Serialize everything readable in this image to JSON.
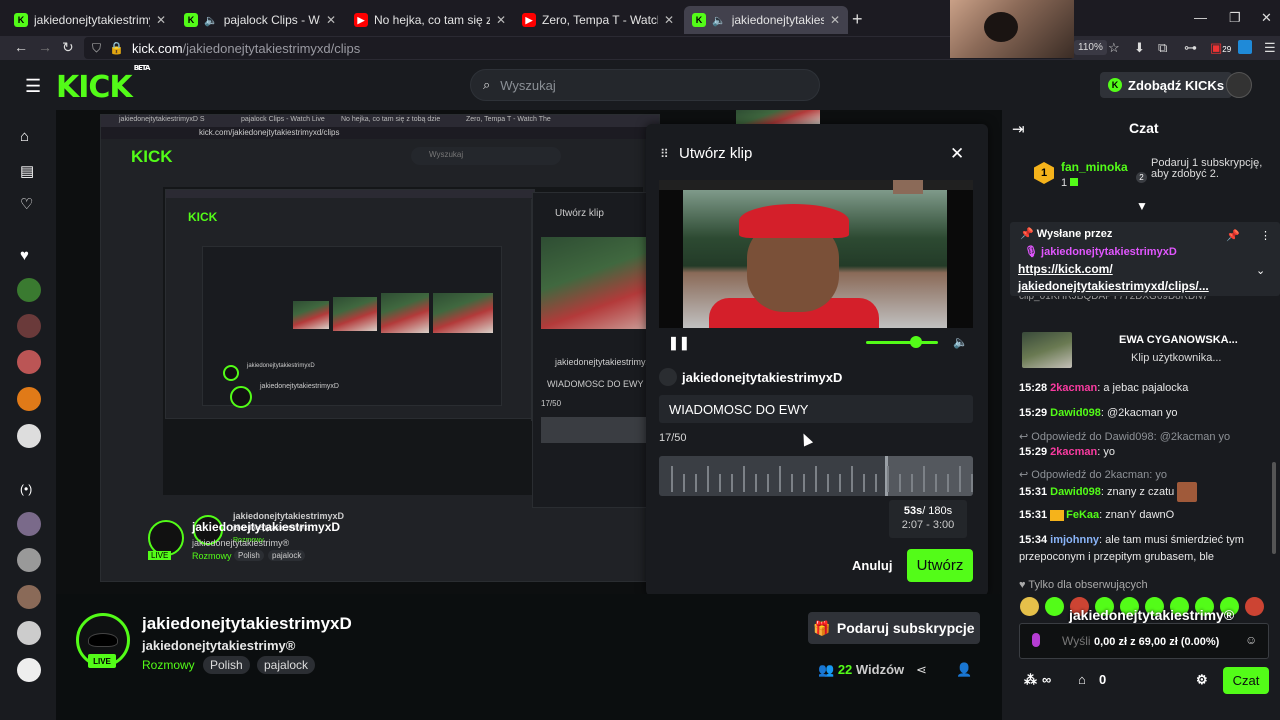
{
  "browser": {
    "tabs": [
      {
        "label": "jakiedonejtytakiestrimyxD S",
        "icon": "kick-favicon",
        "active": false
      },
      {
        "label": "pajalock Clips - Watch Live",
        "icon": "kick-favicon",
        "active": false
      },
      {
        "label": "No hejka, co tam się z tobą dzie",
        "icon": "youtube-favicon",
        "active": false
      },
      {
        "label": "Zero, Tempa T - Watch The",
        "icon": "youtube-favicon",
        "active": false
      },
      {
        "label": "jakiedonejtytakiestrimyxD",
        "icon": "kick-favicon",
        "active": true
      }
    ],
    "url_host": "kick.com",
    "url_path": "/jakiedonejtytakiestrimyxd/clips",
    "zoom": "110%",
    "badge_count": "29"
  },
  "header": {
    "logo": "KICK",
    "logo_tag": "BETA",
    "search_placeholder": "Wyszukaj",
    "kicks_button": "Zdobądź KICKs"
  },
  "nested": {
    "url": "kick.com/jakiedonejtytakiestrimyxd/clips",
    "search": "Wyszukaj",
    "modal_title": "Utwórz klip",
    "username": "jakiedonejtytakiestrimyxD",
    "message": "WIADOMOSC DO EWY",
    "count": "17/50",
    "channel": "jakiedonejtytakiestrimyxD",
    "title": "jakiedonejtytakiestrimy®",
    "category": "Rozmowy",
    "tag1": "Polish",
    "tag2": "pajalock",
    "live": "LIVE",
    "tabs": [
      "jakiedonejtytakiestrimyxD S",
      "pajalock Clips - Watch Live",
      "No hejka, co tam się z tobą dzie",
      "Zero, Tempa T - Watch The"
    ]
  },
  "clip_modal": {
    "title": "Utwórz klip",
    "username": "jakiedonejtytakiestrimyxD",
    "message_value": "WIADOMOSC DO EWY",
    "char_count": "17/50",
    "duration": "53s",
    "duration_max": "/ 180s",
    "range": "2:07 - 3:00",
    "volume": 0.7,
    "cancel_label": "Anuluj",
    "create_label": "Utwórz"
  },
  "channel": {
    "name": "jakiedonejtytakiestrimyxD",
    "title": "jakiedonejtytakiestrimy®",
    "category": "Rozmowy",
    "tags": [
      "Polish",
      "pajalock"
    ],
    "live_label": "LIVE",
    "gift_sub_label": "Podaruj subskrypcje",
    "viewers": "22",
    "viewers_label": "Widzów"
  },
  "chat": {
    "title": "Czat",
    "leaderboard": {
      "rank": "1",
      "name": "fan_minoka",
      "count": "1",
      "next_rank": "2",
      "note": "Podaruj 1 subskrypcję, aby zdobyć 2."
    },
    "pinned": {
      "label": "Wysłane przez",
      "user": "jakiedonejtytakiestrimyxD",
      "link": "https://kick.com/ jakiedonejtytakiestrimyxd/clips/..."
    },
    "prev_link_tail": "clip_01KHRJBQDAPY772DXG69D8RDN7",
    "clip_card": {
      "title": "EWA CYGANOWSKA...",
      "subtitle": "Klip użytkownika..."
    },
    "messages": [
      {
        "time": "15:28",
        "user": "2kacman",
        "color": "#f93ba0",
        "text": "a jebac pajalocka"
      },
      {
        "time": "15:29",
        "user": "Dawid098",
        "color": "#53fc18",
        "text": "@2kacman yo"
      },
      {
        "time": "15:29",
        "user": "2kacman",
        "color": "#f93ba0",
        "text": "yo"
      },
      {
        "time": "15:31",
        "user": "Dawid098",
        "color": "#53fc18",
        "text": "znany z czatu"
      },
      {
        "time": "15:31",
        "user": "FeKaa",
        "color": "#53fc18",
        "text": "znanY dawnO"
      },
      {
        "time": "15:34",
        "user": "imjohnny",
        "color": "#8ab4f8",
        "text": "ale tam musi śmierdzieć tym przepoconym i przepitym grubasem, ble"
      }
    ],
    "replies": [
      "Odpowiedź do Dawid098: @2kacman yo",
      "Odpowiedź do 2kacman: yo"
    ],
    "followers_only": "Tylko dla obserwujących",
    "overlay_name": "jakiedonejtytakiestrimy®",
    "input_placeholder": "Wyśli",
    "money_overlay": "0,00 zł z 69,00 zł (0.00%)",
    "kicks_count": "0",
    "send_label": "Czat"
  }
}
